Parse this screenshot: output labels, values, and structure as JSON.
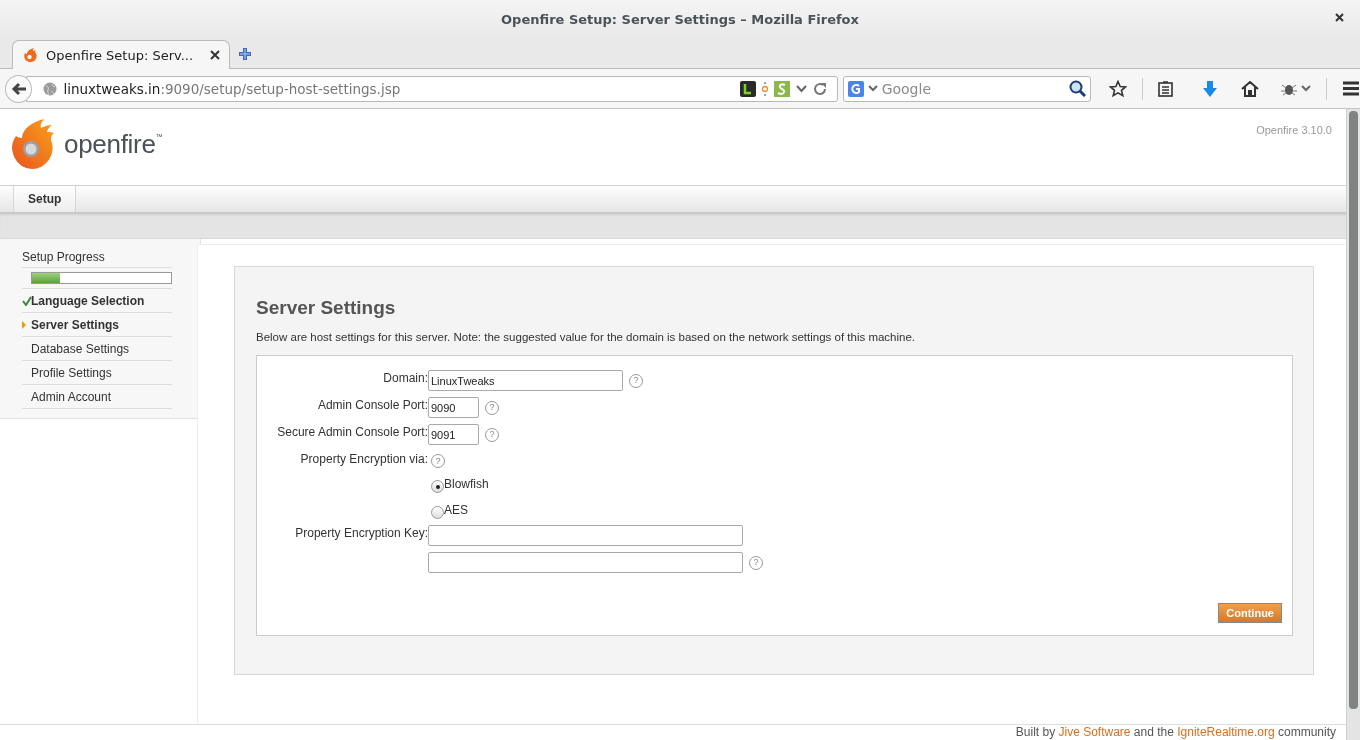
{
  "browser": {
    "window_title": "Openfire Setup: Server Settings – Mozilla Firefox",
    "tabs": [
      {
        "label": "Openfire Setup: Serv...",
        "selected": true
      }
    ],
    "address": {
      "host": "linuxtweaks.in",
      "path": ":9090/setup/setup-host-settings.jsp"
    },
    "search": {
      "placeholder": "Google"
    }
  },
  "header": {
    "logo": "openfire$^{™}$",
    "version": "Openfire 3.10.0"
  },
  "nav": {
    "tabs": [
      {
        "label": "Setup",
        "selected": true
      }
    ]
  },
  "sidebar": {
    "title": "Setup Progress",
    "progress": {
      "level": 0.2
    },
    "steps": [
      {
        "label": "Language Selection",
        "completed": true,
        "selected": false
      },
      {
        "label": "Server Settings",
        "completed": false,
        "selected": true
      },
      {
        "label": "Database Settings",
        "completed": false,
        "selected": false
      },
      {
        "label": "Profile Settings",
        "completed": false,
        "selected": false
      },
      {
        "label": "Admin Account",
        "completed": false,
        "selected": false
      }
    ]
  },
  "form": {
    "heading": "Server Settings",
    "description": "Below are host settings for this server. Note: the suggested value for the domain is based on the network settings of this machine.",
    "fields": [
      {
        "kind": "text",
        "label": "Domain:",
        "value": "LinuxTweaks",
        "help": "?"
      },
      {
        "kind": "port",
        "label": "Admin Console Port:",
        "value": "9090",
        "help": "?"
      },
      {
        "kind": "port",
        "label": "Secure Admin Console Port:",
        "value": "9091",
        "help": "?"
      },
      {
        "kind": "radio",
        "label": "Property Encryption via:",
        "help": "?",
        "options": [
          {
            "label": "Blowfish",
            "selected": true
          },
          {
            "label": "AES",
            "selected": false
          }
        ]
      },
      {
        "kind": "key",
        "label": "Property Encryption Key:"
      },
      {
        "kind": "key",
        "help": "?"
      }
    ],
    "button": "Continue"
  },
  "footer": {
    "segments": [
      {
        "kind": "text",
        "text": "Built by"
      },
      {
        "kind": "link",
        "text": "Jive Software"
      },
      {
        "kind": "text",
        "text": "and the"
      },
      {
        "kind": "link",
        "text": "IgniteRealtime.org"
      },
      {
        "kind": "text",
        "text": "community"
      }
    ]
  }
}
